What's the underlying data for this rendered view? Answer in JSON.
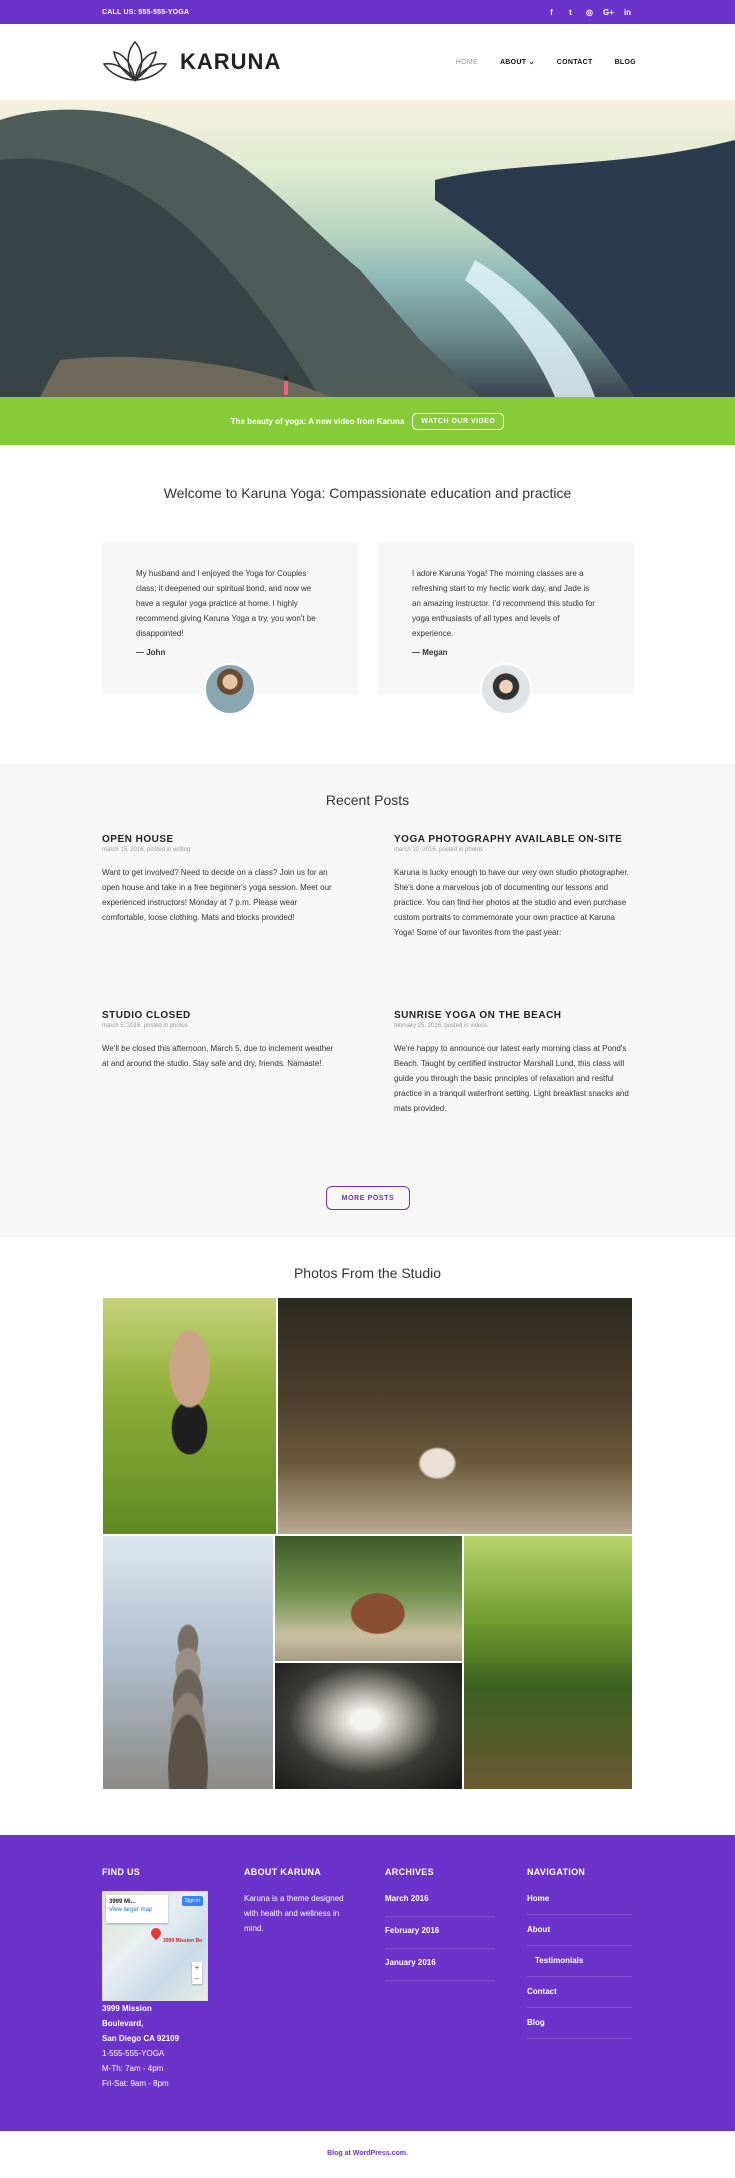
{
  "topbar": {
    "call": "CALL US: 555-555-YOGA"
  },
  "social": [
    "facebook-icon",
    "twitter-icon",
    "instagram-icon",
    "google-plus-icon",
    "linkedin-icon"
  ],
  "brand": {
    "title": "KARUNA"
  },
  "nav": [
    {
      "label": "HOME"
    },
    {
      "label": "ABOUT"
    },
    {
      "label": "CONTACT"
    },
    {
      "label": "BLOG"
    }
  ],
  "banner": {
    "text": "The beauty of yoga: A new video from Karuna",
    "button": "WATCH OUR VIDEO"
  },
  "welcome": {
    "title": "Welcome to Karuna Yoga: Compassionate education and practice",
    "testimonials": [
      {
        "quote": "My husband and I enjoyed the Yoga for Couples class; it deepened our spiritual bond, and now we have a regular yoga practice at home. I highly recommend giving Karuna Yoga a try, you won't be disappointed!",
        "author": "— John"
      },
      {
        "quote": "I adore Karuna Yoga! The morning classes are a refreshing start to my hectic work day, and Jade is an amazing instructor. I'd recommend this studio for yoga enthusiasts of all types and levels of experience.",
        "author": "— Megan"
      }
    ]
  },
  "recent": {
    "title": "Recent Posts",
    "posts": [
      {
        "title": "OPEN HOUSE",
        "meta": "march 15, 2016, posted in writing",
        "excerpt": "Want to get involved? Need to decide on a class? Join us for an open house and take in a free beginner's yoga session. Meet our experienced instructors! Monday at 7 p.m. Please wear comfortable, loose clothing. Mats and blocks provided!"
      },
      {
        "title": "YOGA PHOTOGRAPHY AVAILABLE ON-SITE",
        "meta": "march 10, 2016, posted in photos",
        "excerpt": "Karuna is lucky enough to have our very own studio photographer. She's done a marvelous job of documenting our lessons and practice. You can find her photos at the studio and even purchase custom portraits to commemorate your own practice at Karuna Yoga! Some of our favorites from the past year:"
      },
      {
        "title": "STUDIO CLOSED",
        "meta": "march 5, 2016, posted in photos",
        "excerpt": "We'll be closed this afternoon, March 5, due to inclement weather at and around the studio. Stay safe and dry, friends. Namaste!"
      },
      {
        "title": "SUNRISE YOGA ON THE BEACH",
        "meta": "february 25, 2016, posted in videos",
        "excerpt": "We're happy to announce our latest early morning class at Pond's Beach. Taught by certified instructor Marshall Lund, this class will guide you through the basic principles of relaxation and restful practice in a tranquil waterfront setting. Light breakfast snacks and mats provided."
      }
    ],
    "more": "MORE POSTS"
  },
  "photos": {
    "title": "Photos From the Studio"
  },
  "footer": {
    "find": {
      "title": "FIND US",
      "map_label": "3999 Mi...",
      "map_link": "View larger map",
      "map_signin": "Sign in",
      "map_pin": "3999 Mission Bo",
      "address": [
        "3999 Mission",
        "Boulevard,",
        "San Diego CA 92109"
      ],
      "phone": "1-555-555-YOGA",
      "hours": [
        "M-Th: 7am - 4pm",
        "Fri-Sat: 9am - 8pm"
      ]
    },
    "about": {
      "title": "ABOUT KARUNA",
      "text": "Karuna is a theme designed with health and wellness in mind."
    },
    "archives": {
      "title": "ARCHIVES",
      "items": [
        "March 2016",
        "February 2016",
        "January 2016"
      ]
    },
    "navigation": {
      "title": "NAVIGATION",
      "items": [
        "Home",
        "About",
        "Testimonials",
        "Contact",
        "Blog"
      ]
    }
  },
  "bottom": {
    "credit": "Blog at WordPress.com."
  }
}
